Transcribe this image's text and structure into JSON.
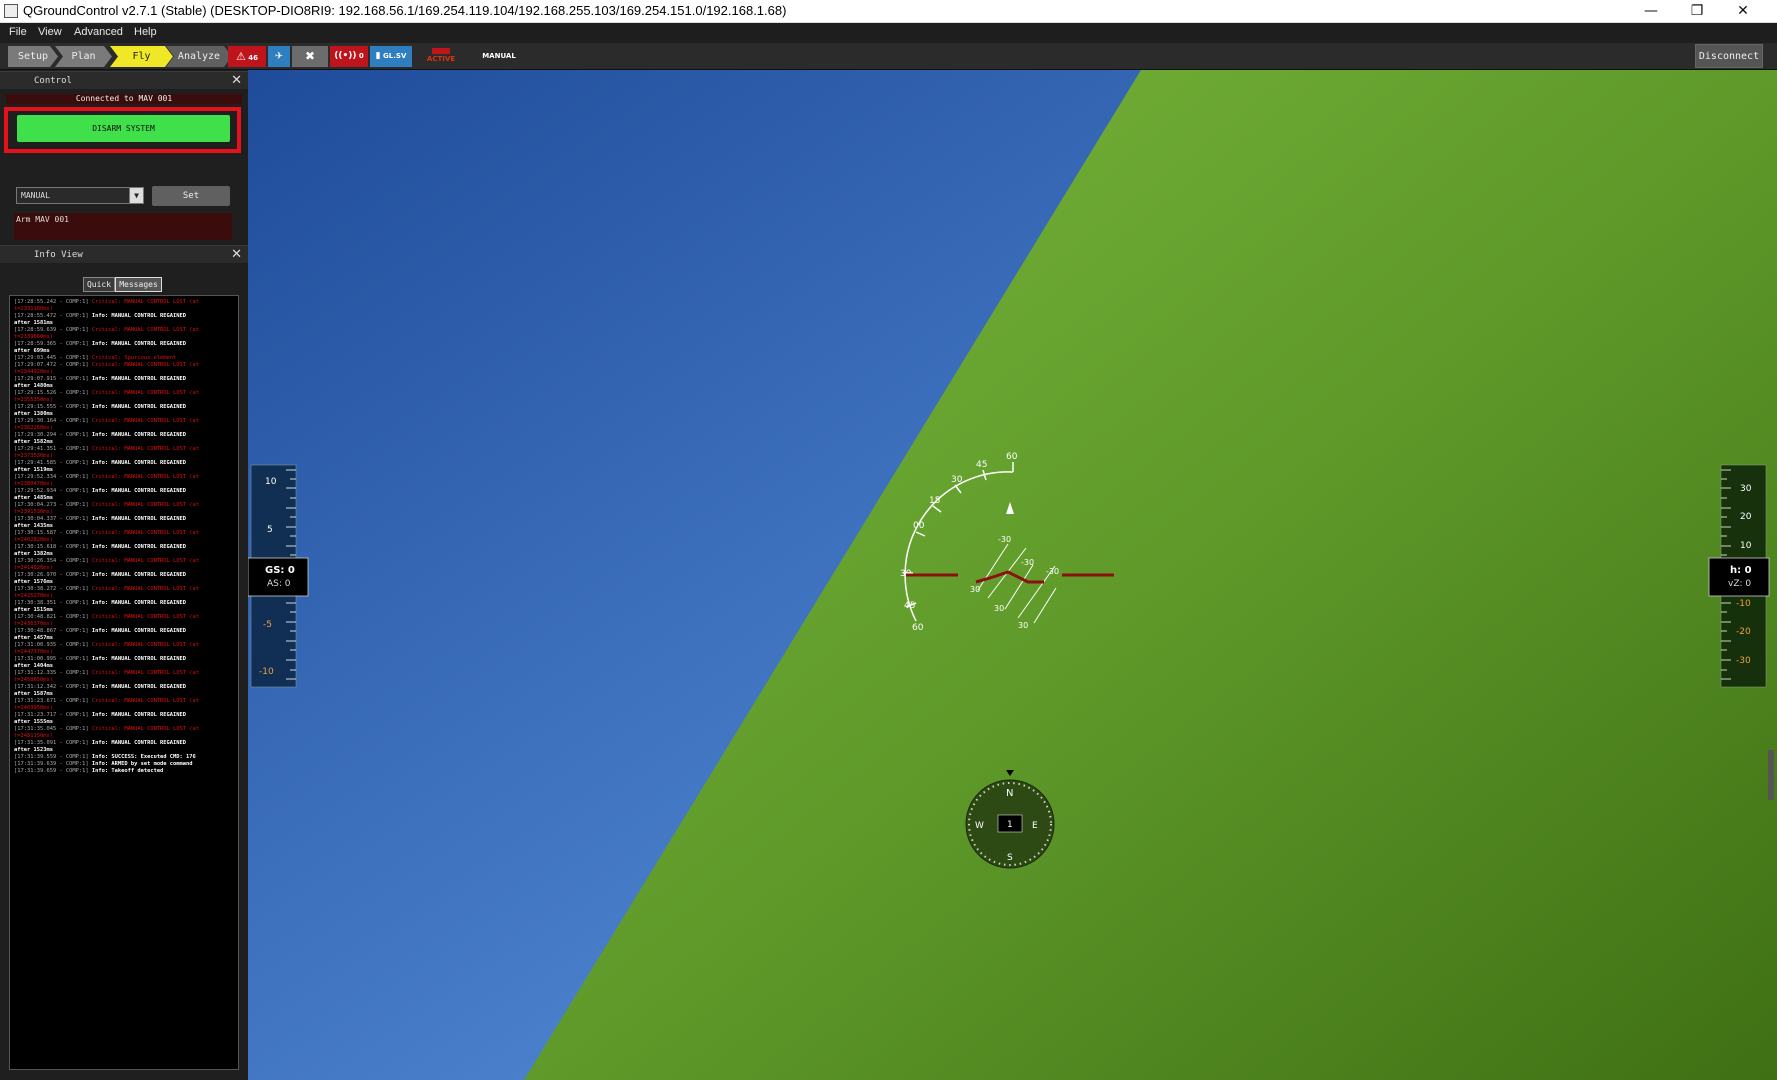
{
  "window": {
    "title": "QGroundControl v2.7.1 (Stable) (DESKTOP-DIO8RI9: 192.168.56.1/169.254.119.104/192.168.255.103/169.254.151.0/192.168.1.68)",
    "minimize": "—",
    "maximize": "❐",
    "close": "✕"
  },
  "menu": {
    "file": "File",
    "view": "View",
    "advanced": "Advanced",
    "help": "Help"
  },
  "toolbar": {
    "tabs": [
      "Setup",
      "Plan",
      "Fly",
      "Analyze"
    ],
    "active_tab": "Fly",
    "indicators": {
      "msg_count": "46",
      "rc_count": "0",
      "gps": "GL.SV",
      "arm_state": "ACTIVE",
      "flight_mode": "MANUAL"
    },
    "disconnect_label": "Disconnect",
    "colors": {
      "active_tab": "#f0e826",
      "alert_red": "#c0141c",
      "info_blue": "#2f7fc0"
    }
  },
  "control_panel": {
    "title": "Control",
    "connected_text": "Connected to MAV 001",
    "disarm_label": "DISARM SYSTEM",
    "mode_value": "MANUAL",
    "set_label": "Set",
    "status_text": "Arm MAV 001"
  },
  "info_panel": {
    "title": "Info View",
    "tabs": [
      "Quick",
      "Messages"
    ],
    "active_tab": "Messages",
    "messages": [
      {
        "ts": "[17:28:55.242 - COMP:1]",
        "level": "critical",
        "text": "Critical: MANUAL CONTROL LOST (at"
      },
      {
        "ts": "",
        "level": "critical",
        "text": "t=2331180ms)"
      },
      {
        "ts": "[17:28:55.472 - COMP:1]",
        "level": "info",
        "text": "Info: MANUAL CONTROL REGAINED"
      },
      {
        "ts": "",
        "level": "info",
        "text": "after 1581ms"
      },
      {
        "ts": "[17:28:59.639 - COMP:1]",
        "level": "critical",
        "text": "Critical: MANUAL CONTROL LOST (at"
      },
      {
        "ts": "",
        "level": "critical",
        "text": "t=2339660ms)"
      },
      {
        "ts": "[17:28:59.365 - COMP:1]",
        "level": "info",
        "text": "Info: MANUAL CONTROL REGAINED"
      },
      {
        "ts": "",
        "level": "info",
        "text": "after 699ms"
      },
      {
        "ts": "[17:29:03.445 - COMP:1]",
        "level": "critical",
        "text": "Critical: Spurious element"
      },
      {
        "ts": "[17:29:07.472 - COMP:1]",
        "level": "critical",
        "text": "Critical: MANUAL CONTROL LOST (at"
      },
      {
        "ts": "",
        "level": "critical",
        "text": "t=2344920ms)"
      },
      {
        "ts": "[17:29:07.915 - COMP:1]",
        "level": "info",
        "text": "Info: MANUAL CONTROL REGAINED"
      },
      {
        "ts": "",
        "level": "info",
        "text": "after 1480ms"
      },
      {
        "ts": "[17:29:15.526 - COMP:1]",
        "level": "critical",
        "text": "Critical: MANUAL CONTROL LOST (at"
      },
      {
        "ts": "",
        "level": "critical",
        "text": "t=2355350ms)"
      },
      {
        "ts": "[17:29:15.555 - COMP:1]",
        "level": "info",
        "text": "Info: MANUAL CONTROL REGAINED"
      },
      {
        "ts": "",
        "level": "info",
        "text": "after 1380ms"
      },
      {
        "ts": "[17:29:30.164 - COMP:1]",
        "level": "critical",
        "text": "Critical: MANUAL CONTROL LOST (at"
      },
      {
        "ts": "",
        "level": "critical",
        "text": "t=2362260ms)"
      },
      {
        "ts": "[17:29:30.294 - COMP:1]",
        "level": "info",
        "text": "Info: MANUAL CONTROL REGAINED"
      },
      {
        "ts": "",
        "level": "info",
        "text": "after 1582ms"
      },
      {
        "ts": "[17:29:41.351 - COMP:1]",
        "level": "critical",
        "text": "Critical: MANUAL CONTROL LOST (at"
      },
      {
        "ts": "",
        "level": "critical",
        "text": "t=2373530ms)"
      },
      {
        "ts": "[17:29:41.585 - COMP:1]",
        "level": "info",
        "text": "Info: MANUAL CONTROL REGAINED"
      },
      {
        "ts": "",
        "level": "info",
        "text": "after 1519ms"
      },
      {
        "ts": "[17:29:52.334 - COMP:1]",
        "level": "critical",
        "text": "Critical: MANUAL CONTROL LOST (at"
      },
      {
        "ts": "",
        "level": "critical",
        "text": "t=2380470ms)"
      },
      {
        "ts": "[17:29:52.934 - COMP:1]",
        "level": "info",
        "text": "Info: MANUAL CONTROL REGAINED"
      },
      {
        "ts": "",
        "level": "info",
        "text": "after 1485ms"
      },
      {
        "ts": "[17:30:04.273 - COMP:1]",
        "level": "critical",
        "text": "Critical: MANUAL CONTROL LOST (at"
      },
      {
        "ts": "",
        "level": "critical",
        "text": "t=2391530ms)"
      },
      {
        "ts": "[17:30:04.337 - COMP:1]",
        "level": "info",
        "text": "Info: MANUAL CONTROL REGAINED"
      },
      {
        "ts": "",
        "level": "info",
        "text": "after 1435ms"
      },
      {
        "ts": "[17:30:15.587 - COMP:1]",
        "level": "critical",
        "text": "Critical: MANUAL CONTROL LOST (at"
      },
      {
        "ts": "",
        "level": "critical",
        "text": "t=2402820ms)"
      },
      {
        "ts": "[17:30:15.618 - COMP:1]",
        "level": "info",
        "text": "Info: MANUAL CONTROL REGAINED"
      },
      {
        "ts": "",
        "level": "info",
        "text": "after 1382ms"
      },
      {
        "ts": "[17:30:26.354 - COMP:1]",
        "level": "critical",
        "text": "Critical: MANUAL CONTROL LOST (at"
      },
      {
        "ts": "",
        "level": "critical",
        "text": "t=2414020ms)"
      },
      {
        "ts": "[17:30:26.970 - COMP:1]",
        "level": "info",
        "text": "Info: MANUAL CONTROL REGAINED"
      },
      {
        "ts": "",
        "level": "info",
        "text": "after 1576ms"
      },
      {
        "ts": "[17:30:38.272 - COMP:1]",
        "level": "critical",
        "text": "Critical: MANUAL CONTROL LOST (at"
      },
      {
        "ts": "",
        "level": "critical",
        "text": "t=2425270ms)"
      },
      {
        "ts": "[17:30:38.351 - COMP:1]",
        "level": "info",
        "text": "Info: MANUAL CONTROL REGAINED"
      },
      {
        "ts": "",
        "level": "info",
        "text": "after 1515ms"
      },
      {
        "ts": "[17:30:48.821 - COMP:1]",
        "level": "critical",
        "text": "Critical: MANUAL CONTROL LOST (at"
      },
      {
        "ts": "",
        "level": "critical",
        "text": "t=2436370ms)"
      },
      {
        "ts": "[17:30:48.867 - COMP:1]",
        "level": "info",
        "text": "Info: MANUAL CONTROL REGAINED"
      },
      {
        "ts": "",
        "level": "info",
        "text": "after 1457ms"
      },
      {
        "ts": "[17:31:00.935 - COMP:1]",
        "level": "critical",
        "text": "Critical: MANUAL CONTROL LOST (at"
      },
      {
        "ts": "",
        "level": "critical",
        "text": "t=2447370ms)"
      },
      {
        "ts": "[17:31:00.995 - COMP:1]",
        "level": "info",
        "text": "Info: MANUAL CONTROL REGAINED"
      },
      {
        "ts": "",
        "level": "info",
        "text": "after 1404ms"
      },
      {
        "ts": "[17:31:12.335 - COMP:1]",
        "level": "critical",
        "text": "Critical: MANUAL CONTROL LOST (at"
      },
      {
        "ts": "",
        "level": "critical",
        "text": "t=2458650ms)"
      },
      {
        "ts": "[17:31:12.342 - COMP:1]",
        "level": "info",
        "text": "Info: MANUAL CONTROL REGAINED"
      },
      {
        "ts": "",
        "level": "info",
        "text": "after 1587ms"
      },
      {
        "ts": "[17:31:23.671 - COMP:1]",
        "level": "critical",
        "text": "Critical: MANUAL CONTROL LOST (at"
      },
      {
        "ts": "",
        "level": "critical",
        "text": "t=2469950ms)"
      },
      {
        "ts": "[17:31:23.717 - COMP:1]",
        "level": "info",
        "text": "Info: MANUAL CONTROL REGAINED"
      },
      {
        "ts": "",
        "level": "info",
        "text": "after 1555ms"
      },
      {
        "ts": "[17:31:35.045 - COMP:1]",
        "level": "critical",
        "text": "Critical: MANUAL CONTROL LOST (at"
      },
      {
        "ts": "",
        "level": "critical",
        "text": "t=2481150ms)"
      },
      {
        "ts": "[17:31:35.091 - COMP:1]",
        "level": "info",
        "text": "Info: MANUAL CONTROL REGAINED"
      },
      {
        "ts": "",
        "level": "info",
        "text": "after 1523ms"
      },
      {
        "ts": "[17:31:39.559 - COMP:1]",
        "level": "info",
        "text": "Info: SUCCESS: Executed CMD: 176"
      },
      {
        "ts": "[17:31:39.639 - COMP:1]",
        "level": "info",
        "text": "Info: ARMED by set mode command"
      },
      {
        "ts": "[17:31:39.659 - COMP:1]",
        "level": "info",
        "text": "Info: Takeoff detected"
      }
    ]
  },
  "hud": {
    "speed_tape": {
      "ticks": [
        "10",
        "5",
        "-5",
        "-10"
      ],
      "gs_label": "GS: 0",
      "as_label": "AS: 0"
    },
    "alt_tape": {
      "ticks": [
        "30",
        "20",
        "10",
        "-10",
        "-20",
        "-30"
      ],
      "h_label": "h: 0",
      "vz_label": "vZ: 0"
    },
    "roll_scale_labels": [
      "60",
      "45",
      "30",
      "15",
      "00",
      "15",
      "30",
      "45",
      "60"
    ],
    "pitch_labels": [
      "-30",
      "30",
      "-30",
      "30",
      "-30",
      "30"
    ],
    "compass": {
      "n": "N",
      "e": "E",
      "s": "S",
      "w": "W",
      "value": "1"
    },
    "colors": {
      "sky": "#3a72c4",
      "ground": "#5f9a2a"
    }
  }
}
